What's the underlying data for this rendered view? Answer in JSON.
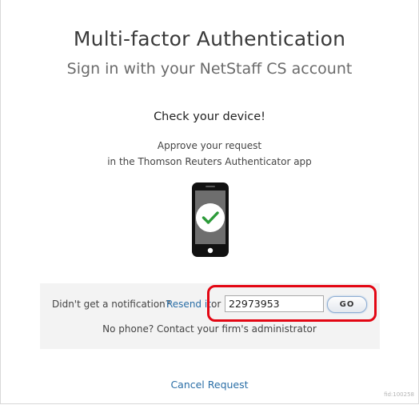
{
  "header": {
    "title": "Multi-factor Authentication",
    "subtitle": "Sign in with your NetStaff CS account"
  },
  "device_check": {
    "heading": "Check your device!",
    "line1": "Approve your request",
    "line2": "in the Thomson Reuters Authenticator app",
    "illustration_icon": "phone-check-icon"
  },
  "fallback": {
    "notification_text": "Didn't get a notification?",
    "resend_label": "Resend it",
    "or_text": "or",
    "code_value": "22973953",
    "go_label": "GO",
    "no_phone_text": "No phone? Contact your firm's administrator"
  },
  "footer": {
    "cancel_label": "Cancel Request",
    "fid_text": "fid:100258"
  },
  "colors": {
    "link": "#2a6ea6",
    "highlight": "#e30613",
    "checkmark": "#2d9b3a",
    "panel_bg": "#f3f3f3"
  }
}
